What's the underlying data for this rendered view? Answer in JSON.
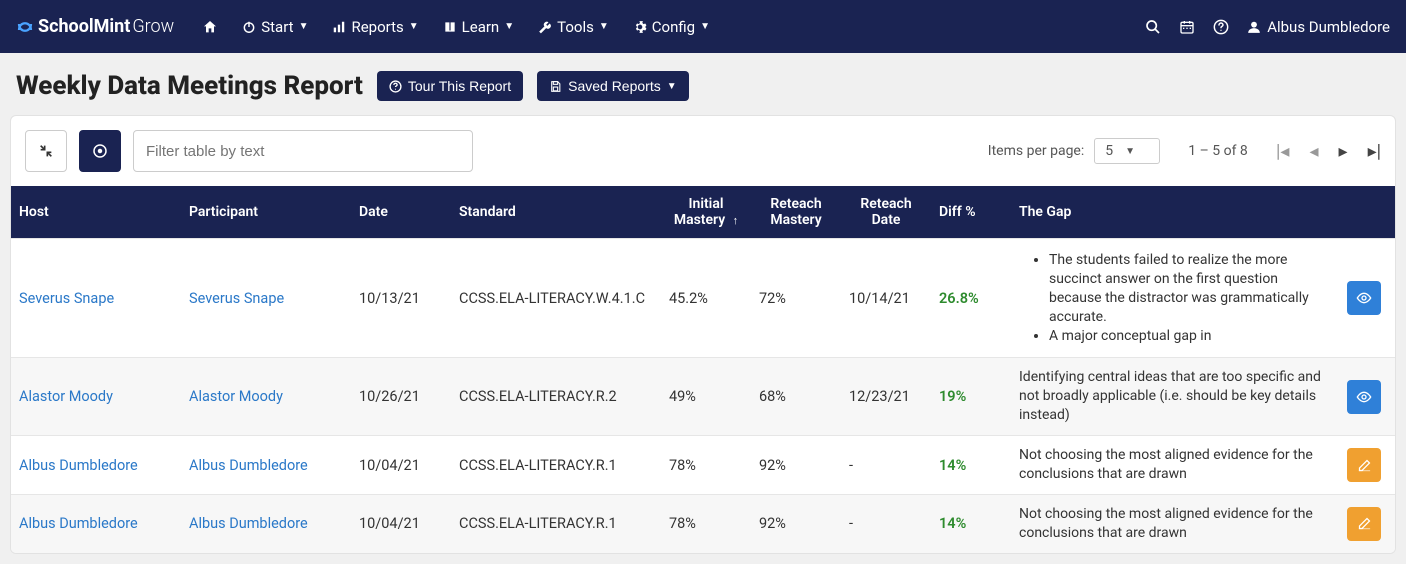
{
  "brand": {
    "bold": "SchoolMint",
    "light": "Grow"
  },
  "nav": {
    "items": [
      {
        "label": "Start",
        "icon": "power"
      },
      {
        "label": "Reports",
        "icon": "bar-chart"
      },
      {
        "label": "Learn",
        "icon": "book"
      },
      {
        "label": "Tools",
        "icon": "wrench"
      },
      {
        "label": "Config",
        "icon": "gear"
      }
    ],
    "user": "Albus Dumbledore"
  },
  "page": {
    "title": "Weekly Data Meetings Report",
    "tour_btn": "Tour This Report",
    "saved_reports_btn": "Saved Reports"
  },
  "toolbar": {
    "filter_placeholder": "Filter table by text",
    "items_per_page_label": "Items per page:",
    "items_per_page_value": "5",
    "page_range": "1 – 5 of 8"
  },
  "table": {
    "headers": {
      "host": "Host",
      "participant": "Participant",
      "date": "Date",
      "standard": "Standard",
      "initial_mastery": "Initial Mastery",
      "reteach_mastery": "Reteach Mastery",
      "reteach_date": "Reteach Date",
      "diff": "Diff %",
      "gap": "The Gap"
    },
    "rows": [
      {
        "host": "Severus Snape",
        "participant": "Severus Snape",
        "date": "10/13/21",
        "standard": "CCSS.ELA-LITERACY.W.4.1.C",
        "initial_mastery": "45.2%",
        "reteach_mastery": "72%",
        "reteach_date": "10/14/21",
        "diff": "26.8%",
        "gap_bullets": [
          "The students failed to realize the more succinct answer on the first question because the distractor was grammatically accurate.",
          "A major conceptual gap in"
        ],
        "action": "view"
      },
      {
        "host": "Alastor Moody",
        "participant": "Alastor Moody",
        "date": "10/26/21",
        "standard": "CCSS.ELA-LITERACY.R.2",
        "initial_mastery": "49%",
        "reteach_mastery": "68%",
        "reteach_date": "12/23/21",
        "diff": "19%",
        "gap_text": "Identifying central ideas that are too specific and not broadly applicable (i.e. should be key details instead)",
        "action": "view"
      },
      {
        "host": "Albus Dumbledore",
        "participant": "Albus Dumbledore",
        "date": "10/04/21",
        "standard": "CCSS.ELA-LITERACY.R.1",
        "initial_mastery": "78%",
        "reteach_mastery": "92%",
        "reteach_date": "-",
        "diff": "14%",
        "gap_text": "Not choosing the most aligned evidence for the conclusions that are drawn",
        "action": "edit"
      },
      {
        "host": "Albus Dumbledore",
        "participant": "Albus Dumbledore",
        "date": "10/04/21",
        "standard": "CCSS.ELA-LITERACY.R.1",
        "initial_mastery": "78%",
        "reteach_mastery": "92%",
        "reteach_date": "-",
        "diff": "14%",
        "gap_text": "Not choosing the most aligned evidence for the conclusions that are drawn",
        "action": "edit"
      }
    ]
  }
}
